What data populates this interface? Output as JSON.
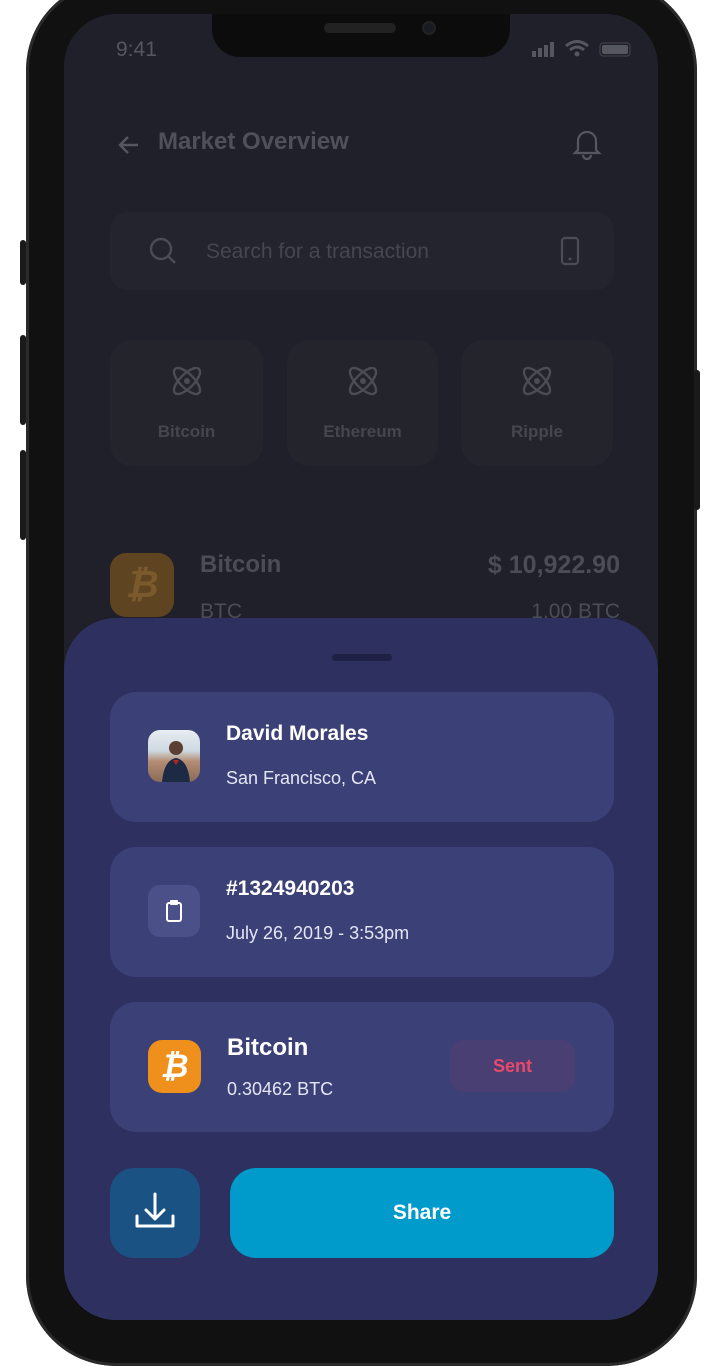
{
  "status_bar": {
    "time": "9:41"
  },
  "header": {
    "title": "Market Overview",
    "back_icon": "arrow-left-icon",
    "bell_icon": "bell-icon"
  },
  "search": {
    "placeholder": "Search for a transaction"
  },
  "coins": [
    {
      "label": "Bitcoin"
    },
    {
      "label": "Ethereum"
    },
    {
      "label": "Ripple"
    }
  ],
  "asset_row": {
    "name": "Bitcoin",
    "symbol": "BTC",
    "price": "$ 10,922.90",
    "amount": "1.00 BTC"
  },
  "sheet": {
    "user": {
      "name": "David Morales",
      "location": "San Francisco, CA"
    },
    "transaction": {
      "id": "#1324940203",
      "datetime": "July 26, 2019 - 3:53pm"
    },
    "coin": {
      "name": "Bitcoin",
      "amount": "0.30462 BTC",
      "status": "Sent"
    },
    "share_label": "Share"
  },
  "colors": {
    "sheet": "#2e3160",
    "card": "#3b4176",
    "share": "#009acb",
    "sent": "#e8496b",
    "bitcoin": "#f0901c"
  }
}
